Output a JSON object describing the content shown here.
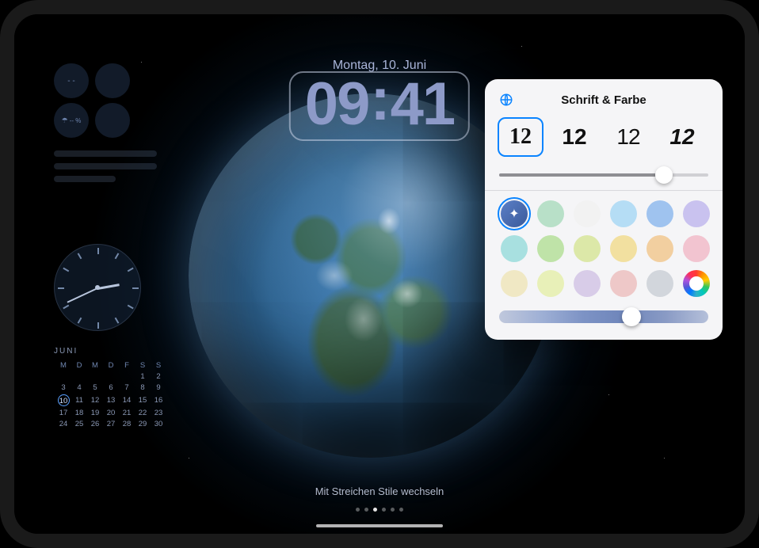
{
  "date_label": "Montag, 10. Juni",
  "time": {
    "hh": "09",
    "mm": "41"
  },
  "widgets": {
    "mini": [
      {
        "name": "wind-widget",
        "text": "- -"
      },
      {
        "name": "sunrise-widget",
        "text": ""
      },
      {
        "name": "precipitation-widget",
        "text": "-- %"
      },
      {
        "name": "empty-widget",
        "text": ""
      }
    ]
  },
  "calendar": {
    "month_label": "Juni",
    "weekdays": [
      "M",
      "D",
      "M",
      "D",
      "F",
      "S",
      "S"
    ],
    "today": 10,
    "weeks": [
      [
        null,
        null,
        null,
        null,
        null,
        "1",
        "2"
      ],
      [
        "3",
        "4",
        "5",
        "6",
        "7",
        "8",
        "9"
      ],
      [
        "10",
        "11",
        "12",
        "13",
        "14",
        "15",
        "16"
      ],
      [
        "17",
        "18",
        "19",
        "20",
        "21",
        "22",
        "23"
      ],
      [
        "24",
        "25",
        "26",
        "27",
        "28",
        "29",
        "30"
      ]
    ]
  },
  "hint_text": "Mit Streichen Stile wechseln",
  "page_dots": {
    "count": 6,
    "active_index": 2
  },
  "popover": {
    "title": "Schrift & Farbe",
    "font_sample": "12",
    "fonts": [
      {
        "name": "font-serif",
        "selected": true
      },
      {
        "name": "font-heavy",
        "selected": false
      },
      {
        "name": "font-light",
        "selected": false
      },
      {
        "name": "font-display",
        "selected": false
      }
    ],
    "weight_slider_pct": 78,
    "colors": [
      {
        "name": "dynamic",
        "hex": "magic",
        "selected": true
      },
      {
        "name": "mint",
        "hex": "#b8e0c8",
        "selected": false
      },
      {
        "name": "white",
        "hex": "#f2f2f2",
        "selected": false
      },
      {
        "name": "sky",
        "hex": "#b5ddf5",
        "selected": false
      },
      {
        "name": "blue",
        "hex": "#9fc3ef",
        "selected": false
      },
      {
        "name": "lilac",
        "hex": "#c9c2ef",
        "selected": false
      },
      {
        "name": "turquoise",
        "hex": "#a8e0e0",
        "selected": false
      },
      {
        "name": "green",
        "hex": "#bfe3a8",
        "selected": false
      },
      {
        "name": "lime",
        "hex": "#dce8a8",
        "selected": false
      },
      {
        "name": "yellow",
        "hex": "#f2e0a0",
        "selected": false
      },
      {
        "name": "peach",
        "hex": "#f2cfa0",
        "selected": false
      },
      {
        "name": "pink",
        "hex": "#f2c4d0",
        "selected": false
      },
      {
        "name": "cream",
        "hex": "#f0e8c4",
        "selected": false
      },
      {
        "name": "lemon",
        "hex": "#e8f0b8",
        "selected": false
      },
      {
        "name": "lavender",
        "hex": "#d8cce8",
        "selected": false
      },
      {
        "name": "rose",
        "hex": "#eec8c8",
        "selected": false
      },
      {
        "name": "gray",
        "hex": "#d2d6dc",
        "selected": false
      },
      {
        "name": "custom-picker",
        "hex": "picker",
        "selected": false
      }
    ],
    "hue_slider_pct": 63
  }
}
